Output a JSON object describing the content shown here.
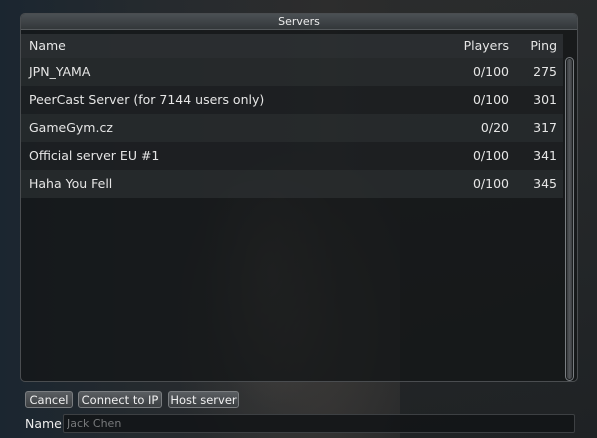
{
  "window": {
    "title": "Servers"
  },
  "columns": {
    "name": "Name",
    "players": "Players",
    "ping": "Ping"
  },
  "servers": [
    {
      "name": "JPN_YAMA",
      "players": "0/100",
      "ping": "275"
    },
    {
      "name": "PeerCast Server (for 7144 users only)",
      "players": "0/100",
      "ping": "301"
    },
    {
      "name": "GameGym.cz",
      "players": "0/20",
      "ping": "317"
    },
    {
      "name": "Official server EU #1",
      "players": "0/100",
      "ping": "341"
    },
    {
      "name": "Haha You Fell",
      "players": "0/100",
      "ping": "345"
    }
  ],
  "buttons": {
    "cancel": "Cancel",
    "connect_ip": "Connect to IP",
    "host": "Host server"
  },
  "name_field": {
    "label": "Name",
    "placeholder": "Jack Chen"
  }
}
